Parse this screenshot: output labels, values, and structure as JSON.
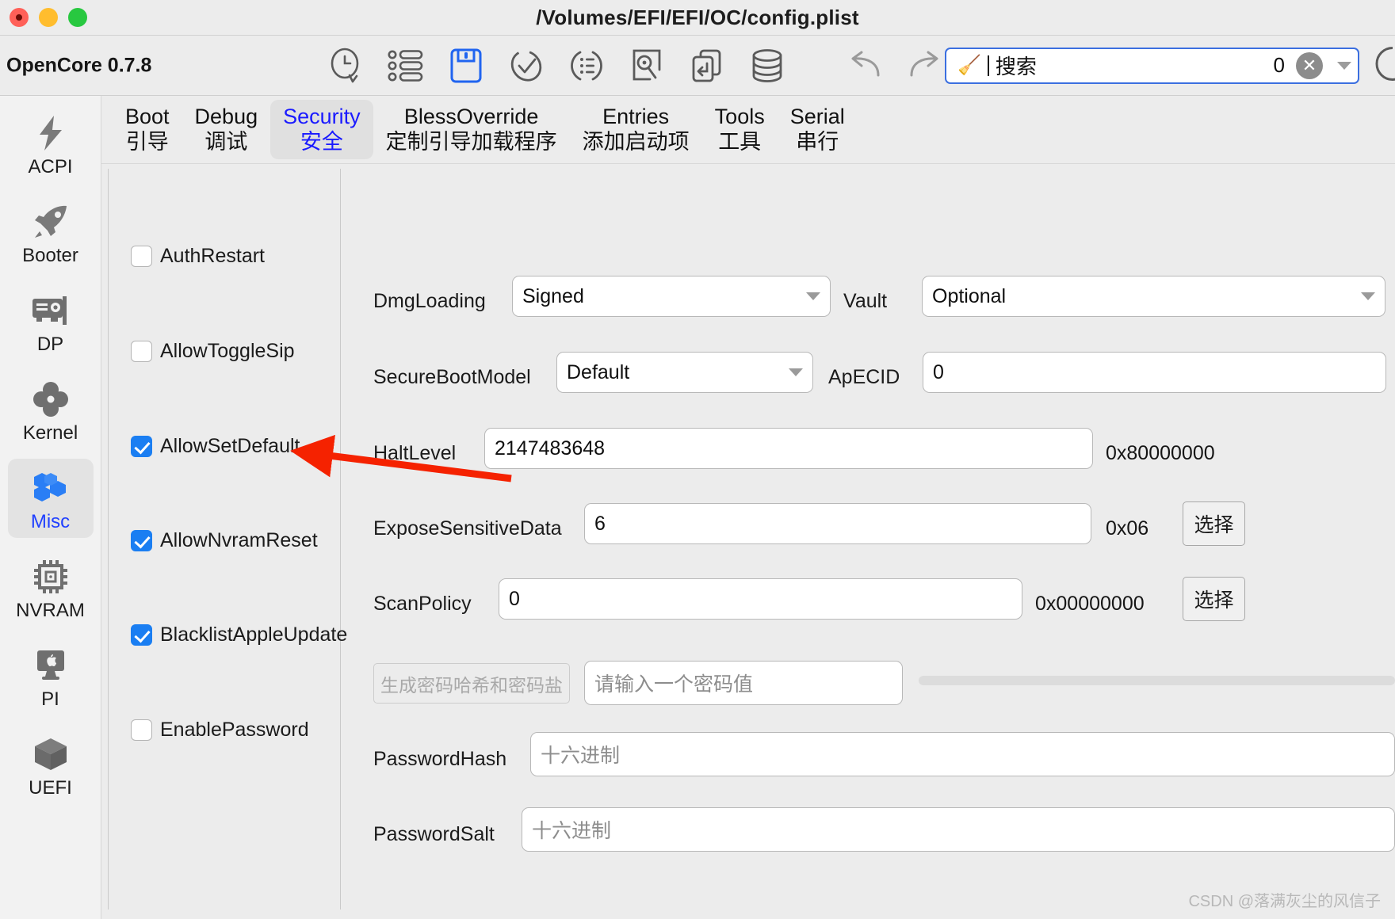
{
  "window": {
    "title": "/Volumes/EFI/EFI/OC/config.plist",
    "app_name": "OpenCore 0.7.8",
    "traffic_lights": [
      "close-red",
      "minimize-yellow",
      "zoom-green"
    ]
  },
  "toolbar": {
    "icons": [
      {
        "name": "history-search-icon",
        "label": "History"
      },
      {
        "name": "list-view-icon",
        "label": "List"
      },
      {
        "name": "save-icon",
        "label": "Save",
        "active": true,
        "color": "#2064f0"
      },
      {
        "name": "validate-check-icon",
        "label": "Validate"
      },
      {
        "name": "reorder-list-icon",
        "label": "Reorder"
      },
      {
        "name": "snapshot-icon",
        "label": "Snapshot"
      },
      {
        "name": "import-icon",
        "label": "Import"
      },
      {
        "name": "database-icon",
        "label": "Database"
      }
    ],
    "undo_label": "Undo",
    "redo_label": "Redo",
    "refresh_label": "Refresh"
  },
  "search": {
    "icon": "broom-icon",
    "glyph": "🧹",
    "placeholder": "搜索",
    "value": "",
    "match_count": "0",
    "clear_label": "✕",
    "dropdown": "chevron-down-icon",
    "border_color": "#3b6fe0"
  },
  "sidebar": {
    "items": [
      {
        "icon": "lightning-bolt-icon",
        "label": "ACPI",
        "active": false
      },
      {
        "icon": "rocket-icon",
        "label": "Booter",
        "active": false
      },
      {
        "icon": "graphics-card-icon",
        "label": "DP",
        "active": false
      },
      {
        "icon": "clover-icon",
        "label": "Kernel",
        "active": false
      },
      {
        "icon": "hexagons-icon",
        "label": "Misc",
        "active": true
      },
      {
        "icon": "cpu-chip-icon",
        "label": "NVRAM",
        "active": false
      },
      {
        "icon": "imac-apple-icon",
        "label": "PI",
        "active": false
      },
      {
        "icon": "cube-icon",
        "label": "UEFI",
        "active": false
      }
    ],
    "active_color": "#2040ff"
  },
  "tabs": [
    {
      "en": "Boot",
      "cn": "引导",
      "active": false
    },
    {
      "en": "Debug",
      "cn": "调试",
      "active": false
    },
    {
      "en": "Security",
      "cn": "安全",
      "active": true
    },
    {
      "en": "BlessOverride",
      "cn": "定制引导加载程序",
      "active": false
    },
    {
      "en": "Entries",
      "cn": "添加启动项",
      "active": false
    },
    {
      "en": "Tools",
      "cn": "工具",
      "active": false
    },
    {
      "en": "Serial",
      "cn": "串行",
      "active": false
    }
  ],
  "checkboxes": [
    {
      "label": "AuthRestart",
      "checked": false
    },
    {
      "label": "AllowToggleSip",
      "checked": false
    },
    {
      "label": "AllowSetDefault",
      "checked": true
    },
    {
      "label": "AllowNvramReset",
      "checked": true
    },
    {
      "label": "BlacklistAppleUpdate",
      "checked": true
    },
    {
      "label": "EnablePassword",
      "checked": false
    }
  ],
  "form": {
    "dmg_loading_label": "DmgLoading",
    "dmg_loading_value": "Signed",
    "vault_label": "Vault",
    "vault_value": "Optional",
    "secure_boot_label": "SecureBootModel",
    "secure_boot_value": "Default",
    "apecid_label": "ApECID",
    "apecid_value": "0",
    "halt_level_label": "HaltLevel",
    "halt_level_value": "2147483648",
    "halt_level_hex": "0x80000000",
    "expose_label": "ExposeSensitiveData",
    "expose_value": "6",
    "expose_hex": "0x06",
    "expose_button": "选择",
    "scan_policy_label": "ScanPolicy",
    "scan_policy_value": "0",
    "scan_policy_hex": "0x00000000",
    "scan_policy_button": "选择",
    "generate_button": "生成密码哈希和密码盐",
    "password_placeholder": "请输入一个密码值",
    "password_value": "",
    "password_hash_label": "PasswordHash",
    "password_hash_placeholder": "十六进制",
    "password_hash_value": "",
    "password_salt_label": "PasswordSalt",
    "password_salt_placeholder": "十六进制",
    "password_salt_value": ""
  },
  "annotation": {
    "name": "red-arrow-annotation",
    "color": "#f52200",
    "points_to": "AllowSetDefault"
  },
  "watermark": "CSDN @落满灰尘的风信子"
}
